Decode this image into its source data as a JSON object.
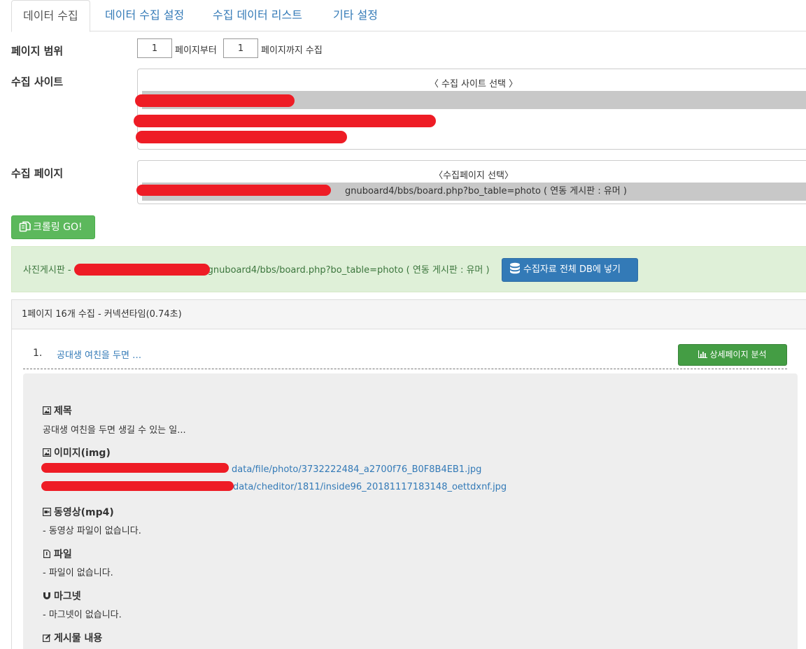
{
  "tabs": [
    "데이터 수집",
    "데이터 수집 설정",
    "수집 데이터 리스트",
    "기타 설정"
  ],
  "page_range": {
    "label": "페이지 범위",
    "from_value": "1",
    "from_suffix": "페이지부터",
    "to_value": "1",
    "to_suffix": "페이지까지 수집"
  },
  "site": {
    "label": "수집 사이트",
    "title": "〈 수집 사이트 선택 〉"
  },
  "page": {
    "label": "수집 페이지",
    "title": "〈수집페이지 선택〉",
    "option_suffix": "gnuboard4/bbs/board.php?bo_table=photo ( 연동 게시판 : 유머 )"
  },
  "crawl_button": "크롤링 GO!",
  "alert": {
    "prefix": "사진게시판 -",
    "suffix": "gnuboard4/bbs/board.php?bo_table=photo ( 연동 게시판 : 유머 )",
    "db_button": "수집자료 전체 DB에 넣기"
  },
  "result": {
    "summary": "1페이지 16개 수집 - 커넥션타임(0.74초)",
    "item_number": "1.",
    "item_title": "공대생 여친을 두면 …",
    "detail_button": "상세페이지 분석"
  },
  "detail": {
    "title_label": "제목",
    "title_value": "공대생 여친을 두면 생길 수 있는 일...",
    "image_label": "이미지(img)",
    "image_links": [
      "data/file/photo/3732222484_a2700f76_B0F8B4EB1.jpg",
      "data/cheditor/1811/inside96_20181117183148_oettdxnf.jpg"
    ],
    "video_label": "동영상(mp4)",
    "video_value": "- 동영상 파일이 없습니다.",
    "file_label": "파일",
    "file_value": "- 파일이 없습니다.",
    "magnet_label": "마그넷",
    "magnet_value": "- 마그넷이 없습니다.",
    "content_label": "게시물 내용"
  },
  "colors": {
    "link": "#337ab7",
    "success": "#5cb85c",
    "primary": "#337ab7",
    "alert_bg": "#dff0d8",
    "redaction": "#ee1c25"
  }
}
